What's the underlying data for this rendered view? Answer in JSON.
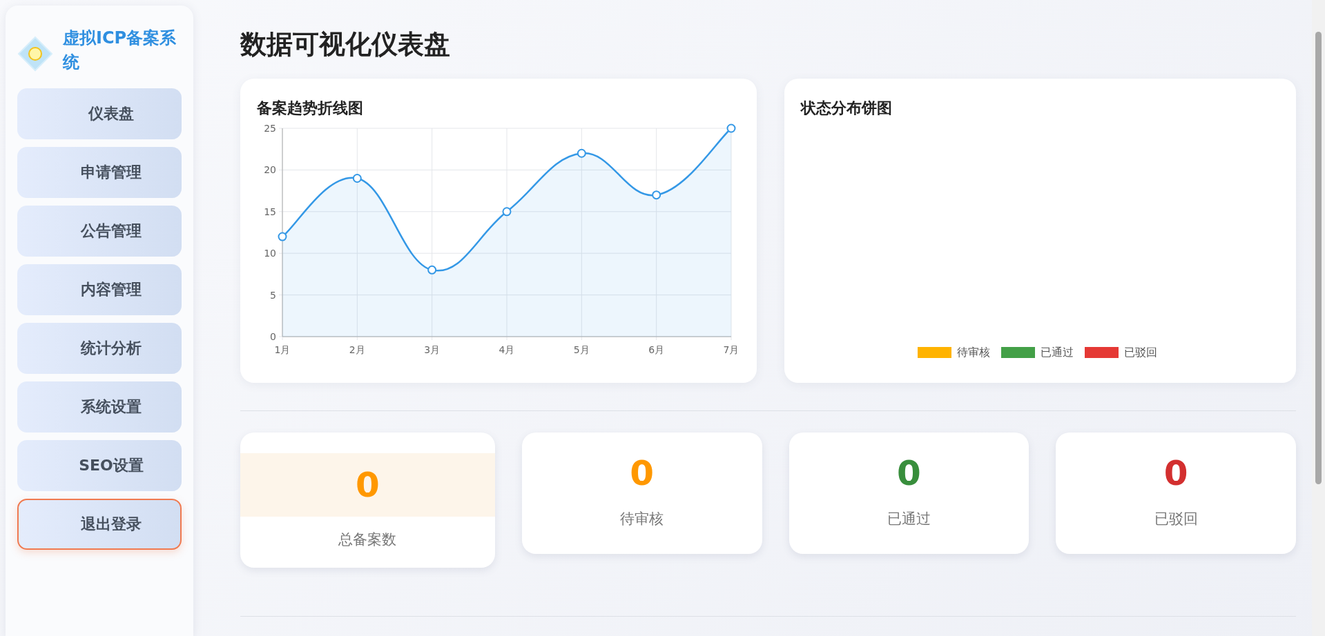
{
  "sidebar": {
    "title": "虚拟ICP备案系统",
    "items": [
      {
        "label": "仪表盘",
        "kind": "nav"
      },
      {
        "label": "申请管理",
        "kind": "nav"
      },
      {
        "label": "公告管理",
        "kind": "nav"
      },
      {
        "label": "内容管理",
        "kind": "nav"
      },
      {
        "label": "统计分析",
        "kind": "nav"
      },
      {
        "label": "系统设置",
        "kind": "nav"
      },
      {
        "label": "SEO设置",
        "kind": "nav"
      },
      {
        "label": "退出登录",
        "kind": "logout"
      }
    ]
  },
  "page_title": "数据可视化仪表盘",
  "trend_panel": {
    "title": "备案趋势折线图",
    "chart_data": {
      "type": "area",
      "categories": [
        "1月",
        "2月",
        "3月",
        "4月",
        "5月",
        "6月",
        "7月"
      ],
      "series": [
        {
          "color": "#3498e6",
          "values": [
            12,
            19,
            8,
            15,
            22,
            17,
            25
          ]
        }
      ],
      "grid": true,
      "ylim": [
        0,
        25
      ],
      "yticks": [
        0,
        5,
        10,
        15,
        20,
        25
      ]
    }
  },
  "status_panel": {
    "title": "状态分布饼图",
    "legend": [
      {
        "label": "待审核",
        "color": "#ffb300"
      },
      {
        "label": "已通过",
        "color": "#43a047"
      },
      {
        "label": "已驳回",
        "color": "#e53935"
      }
    ]
  },
  "stats": [
    {
      "value": "0",
      "label": "总备案数",
      "color": "#ff9800",
      "highlighted": true
    },
    {
      "value": "0",
      "label": "待审核",
      "color": "#ff9800",
      "highlighted": false
    },
    {
      "value": "0",
      "label": "已通过",
      "color": "#388e3c",
      "highlighted": false
    },
    {
      "value": "0",
      "label": "已驳回",
      "color": "#d32f2f",
      "highlighted": false
    }
  ]
}
